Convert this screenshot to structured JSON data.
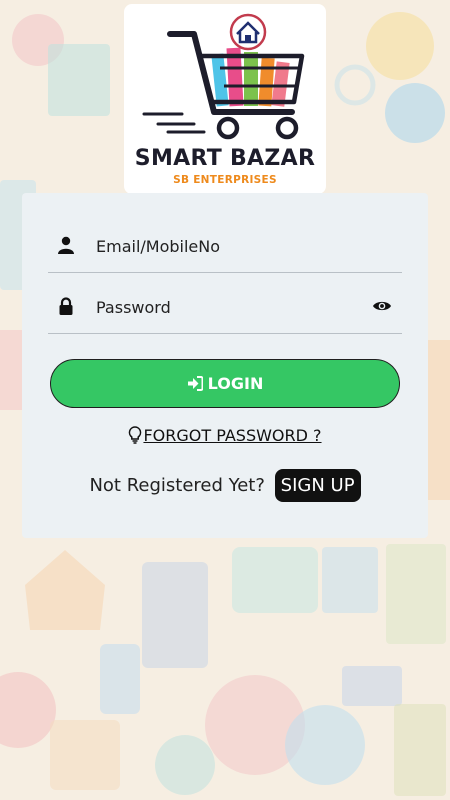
{
  "app": {
    "brand_name": "SMART BAZAR",
    "brand_subtitle": "SB ENTERPRISES"
  },
  "login_form": {
    "email_placeholder": "Email/MobileNo",
    "password_placeholder": "Password",
    "login_label": "LOGIN",
    "forgot_label": "FORGOT PASSWORD ?",
    "not_registered_text": "Not Registered Yet?",
    "signup_label": "SIGN UP"
  },
  "colors": {
    "login_button": "#35c764",
    "signup_button": "#111111",
    "card_background": "#ecf1f4",
    "brand_accent": "#ee8a1c"
  },
  "icons": [
    "user-icon",
    "lock-icon",
    "eye-icon",
    "sign-in-icon",
    "lightbulb-icon",
    "shopping-cart-logo"
  ]
}
